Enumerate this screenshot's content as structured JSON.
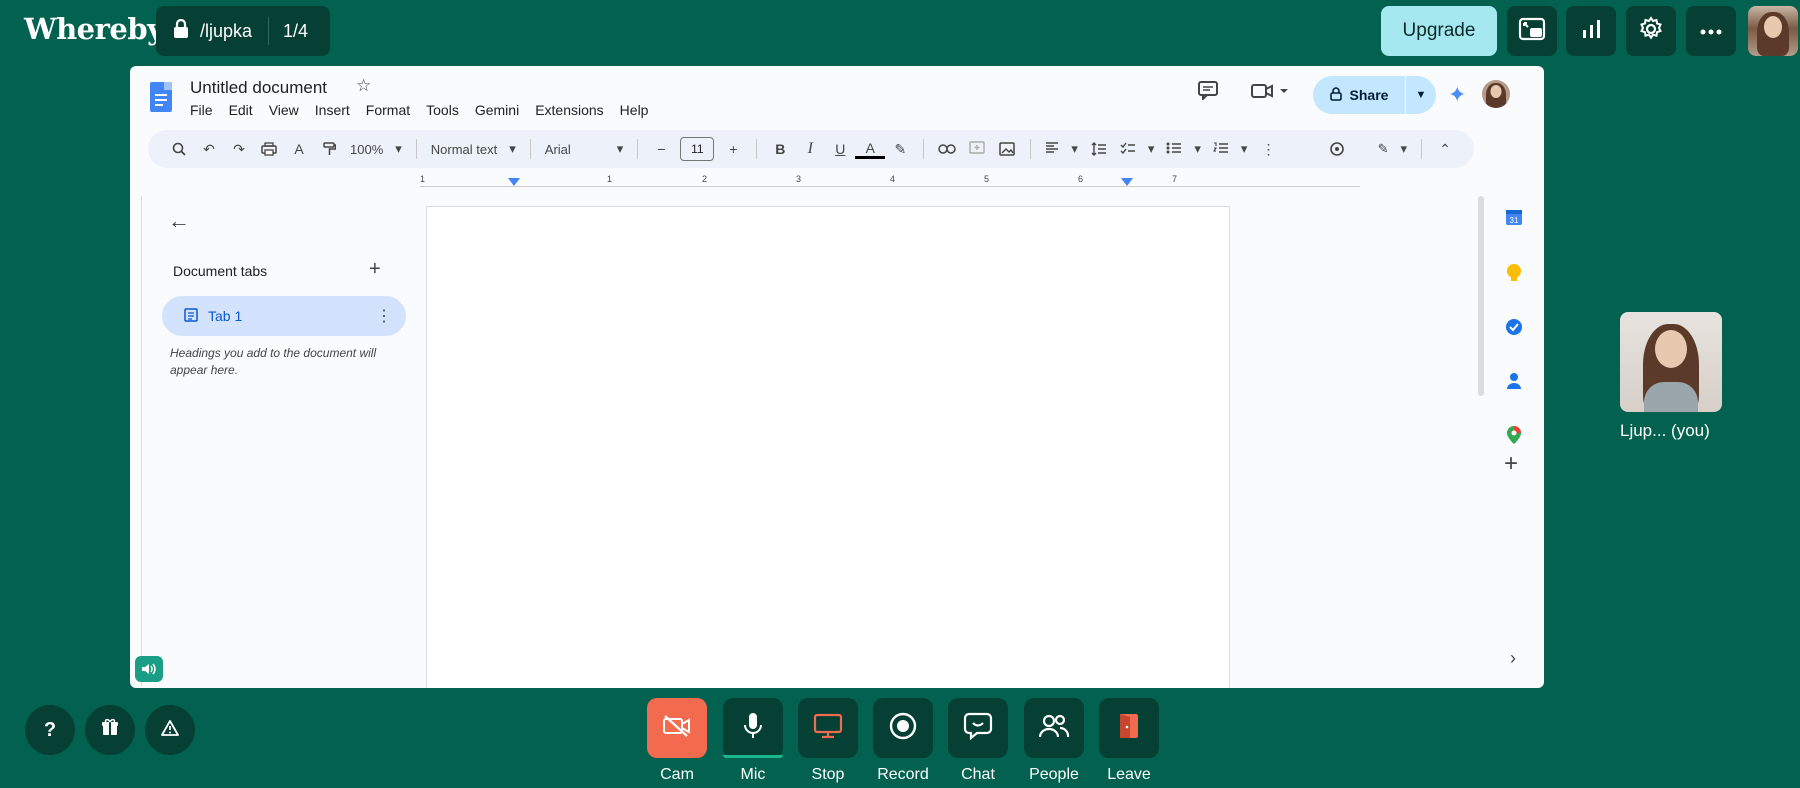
{
  "app": {
    "brand": "Whereby"
  },
  "room": {
    "name": "/ljupka",
    "count": "1/4"
  },
  "header": {
    "upgrade_label": "Upgrade"
  },
  "doc": {
    "title": "Untitled document",
    "menu": [
      "File",
      "Edit",
      "View",
      "Insert",
      "Format",
      "Tools",
      "Gemini",
      "Extensions",
      "Help"
    ],
    "share_label": "Share",
    "toolbar": {
      "zoom": "100%",
      "style": "Normal text",
      "font": "Arial",
      "font_size": "11"
    },
    "ruler_numbers": [
      "1",
      "1",
      "2",
      "3",
      "4",
      "5",
      "6",
      "7"
    ],
    "tabs_label": "Document tabs",
    "tab1": "Tab 1",
    "tabs_hint": "Headings you add to the document will appear here."
  },
  "self_view": {
    "name": "Ljup...  (you)"
  },
  "controls": {
    "cam": "Cam",
    "mic": "Mic",
    "stop": "Stop",
    "record": "Record",
    "chat": "Chat",
    "people": "People",
    "leave": "Leave"
  },
  "colors": {
    "background": "#02614f",
    "dark_button": "#063f34",
    "upgrade": "#a6e8f0",
    "cam_off": "#f26b4f",
    "mic_active": "#1ab88c",
    "share": "#c2e7ff",
    "tab_active": "#d3e3fd"
  }
}
